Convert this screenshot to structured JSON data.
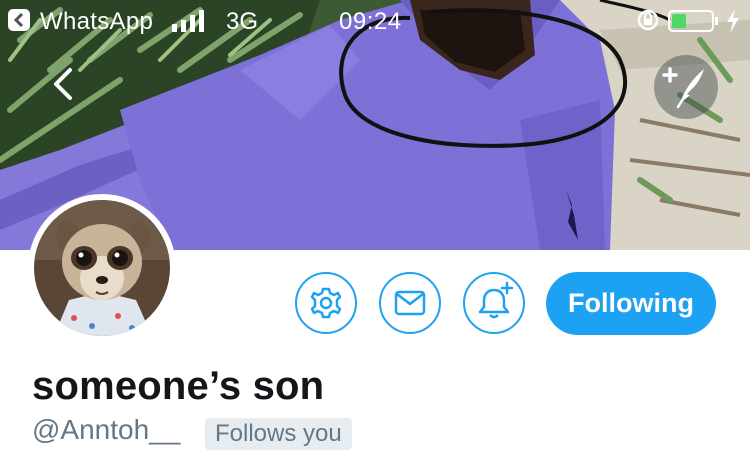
{
  "status_bar": {
    "app_name": "WhatsApp",
    "network": "3G",
    "time": "09:24",
    "battery_color": "#4cd964"
  },
  "profile": {
    "display_name": "someone’s son",
    "handle": "@Anntoh__",
    "follows_badge": "Follows you"
  },
  "actions": {
    "following_label": "Following",
    "icons": [
      "gear-icon",
      "mail-icon",
      "bell-plus-icon"
    ]
  },
  "colors": {
    "accent": "#1da1f2",
    "name_text": "#14171a",
    "secondary_text": "#657786",
    "badge_bg": "#e6ecf0"
  }
}
